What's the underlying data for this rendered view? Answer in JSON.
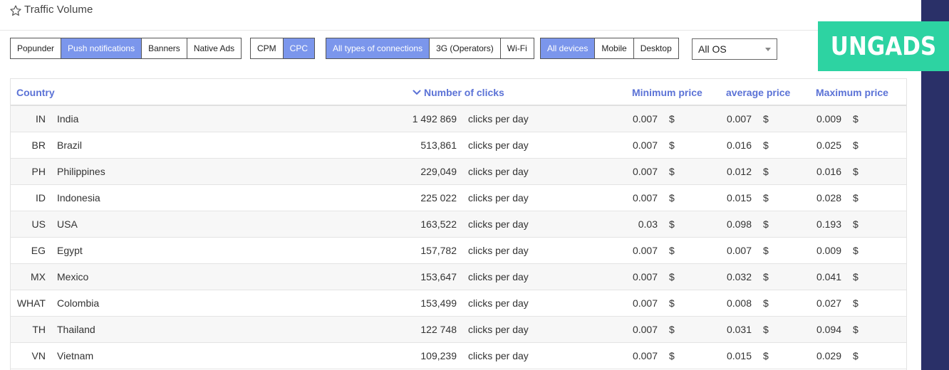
{
  "header": {
    "title": "Traffic Volume"
  },
  "brand": {
    "name": "UNGADS",
    "color": "#2dd3a2"
  },
  "colors": {
    "accent": "#7b96ec",
    "header_text": "#5b72d6",
    "right_band": "#2a3068"
  },
  "filters": {
    "format": [
      {
        "label": "Popunder",
        "active": false
      },
      {
        "label": "Push notifications",
        "active": true
      },
      {
        "label": "Banners",
        "active": false
      },
      {
        "label": "Native Ads",
        "active": false
      }
    ],
    "pricing": [
      {
        "label": "CPM",
        "active": false
      },
      {
        "label": "CPC",
        "active": true
      }
    ],
    "connection": [
      {
        "label": "All types of connections",
        "active": true
      },
      {
        "label": "3G (Operators)",
        "active": false
      },
      {
        "label": "Wi-Fi",
        "active": false
      }
    ],
    "device": [
      {
        "label": "All devices",
        "active": true
      },
      {
        "label": "Mobile",
        "active": false
      },
      {
        "label": "Desktop",
        "active": false
      }
    ],
    "os_select": {
      "value": "All OS"
    }
  },
  "table": {
    "headers": {
      "country": "Country",
      "clicks": "Number of clicks",
      "min_price": "Minimum price",
      "avg_price": "average price",
      "max_price": "Maximum price"
    },
    "sort_icon": "chevron-down-icon",
    "rows": [
      {
        "code": "IN",
        "country": "India",
        "clicks": "1 492 869",
        "unit": "clicks per day",
        "min": "0.007",
        "min_cur": "$",
        "avg": "0.007",
        "avg_cur": "$",
        "max": "0.009",
        "max_cur": "$"
      },
      {
        "code": "BR",
        "country": "Brazil",
        "clicks": "513,861",
        "unit": "clicks per day",
        "min": "0.007",
        "min_cur": "$",
        "avg": "0.016",
        "avg_cur": "$",
        "max": "0.025",
        "max_cur": "$"
      },
      {
        "code": "PH",
        "country": "Philippines",
        "clicks": "229,049",
        "unit": "clicks per day",
        "min": "0.007",
        "min_cur": "$",
        "avg": "0.012",
        "avg_cur": "$",
        "max": "0.016",
        "max_cur": "$"
      },
      {
        "code": "ID",
        "country": "Indonesia",
        "clicks": "225 022",
        "unit": "clicks per day",
        "min": "0.007",
        "min_cur": "$",
        "avg": "0.015",
        "avg_cur": "$",
        "max": "0.028",
        "max_cur": "$"
      },
      {
        "code": "US",
        "country": "USA",
        "clicks": "163,522",
        "unit": "clicks per day",
        "min": "0.03",
        "min_cur": "$",
        "avg": "0.098",
        "avg_cur": "$",
        "max": "0.193",
        "max_cur": "$"
      },
      {
        "code": "EG",
        "country": "Egypt",
        "clicks": "157,782",
        "unit": "clicks per day",
        "min": "0.007",
        "min_cur": "$",
        "avg": "0.007",
        "avg_cur": "$",
        "max": "0.009",
        "max_cur": "$"
      },
      {
        "code": "MX",
        "country": "Mexico",
        "clicks": "153,647",
        "unit": "clicks per day",
        "min": "0.007",
        "min_cur": "$",
        "avg": "0.032",
        "avg_cur": "$",
        "max": "0.041",
        "max_cur": "$"
      },
      {
        "code": "WHAT",
        "country": "Colombia",
        "clicks": "153,499",
        "unit": "clicks per day",
        "min": "0.007",
        "min_cur": "$",
        "avg": "0.008",
        "avg_cur": "$",
        "max": "0.027",
        "max_cur": "$"
      },
      {
        "code": "TH",
        "country": "Thailand",
        "clicks": "122 748",
        "unit": "clicks per day",
        "min": "0.007",
        "min_cur": "$",
        "avg": "0.031",
        "avg_cur": "$",
        "max": "0.094",
        "max_cur": "$"
      },
      {
        "code": "VN",
        "country": "Vietnam",
        "clicks": "109,239",
        "unit": "clicks per day",
        "min": "0.007",
        "min_cur": "$",
        "avg": "0.015",
        "avg_cur": "$",
        "max": "0.029",
        "max_cur": "$"
      }
    ]
  }
}
